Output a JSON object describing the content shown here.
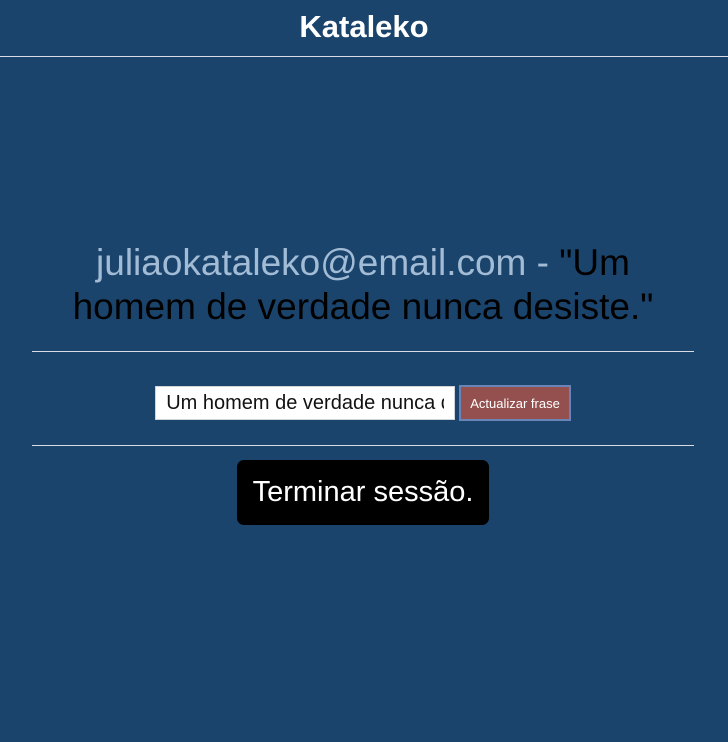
{
  "header": {
    "title": "Kataleko"
  },
  "profile": {
    "email": "juliaokataleko@email.com",
    "separator": " - ",
    "quote_display": "\"Um homem de verdade nunca desiste.\""
  },
  "phrase_form": {
    "input_value": "Um homem de verdade nunca desiste.",
    "submit_label": "Actualizar frase"
  },
  "session": {
    "logout_label": "Terminar sessão."
  },
  "colors": {
    "background": "#1b446d",
    "email_text": "#a3bcd6",
    "update_button_bg": "#93504e",
    "logout_button_bg": "#000000"
  }
}
